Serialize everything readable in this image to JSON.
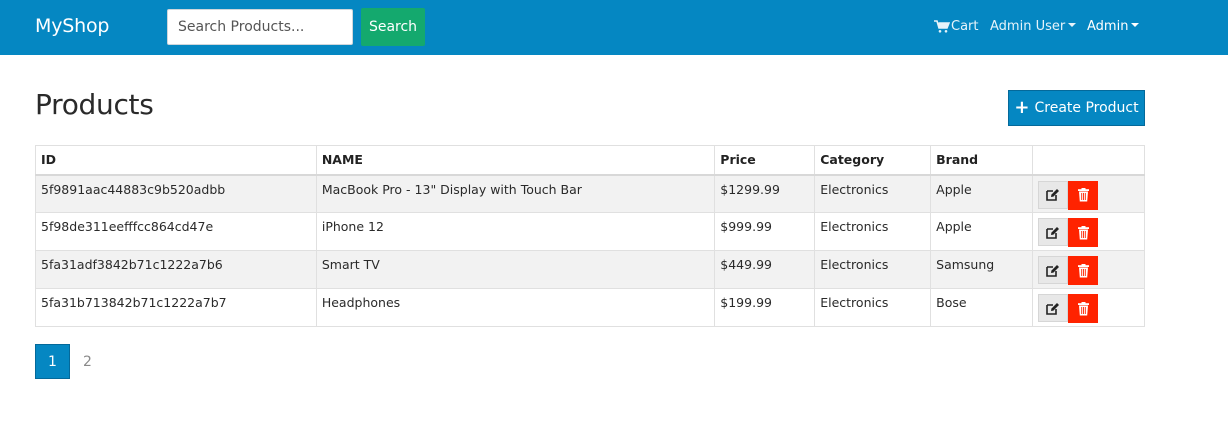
{
  "navbar": {
    "brand": "MyShop",
    "search_placeholder": "Search Products...",
    "search_button": "Search",
    "cart_label": "Cart",
    "cart_icon": "shopping-cart-icon",
    "admin_user_label": "Admin User",
    "admin_label": "Admin",
    "background_color": "#0587c2",
    "search_button_color": "#14a96e"
  },
  "page": {
    "title": "Products",
    "create_button": "Create Product"
  },
  "table": {
    "headers": [
      "ID",
      "NAME",
      "Price",
      "Category",
      "Brand",
      ""
    ],
    "rows": [
      {
        "id": "5f9891aac44883c9b520adbb",
        "name": "MacBook Pro - 13\" Display with Touch Bar",
        "price": "$1299.99",
        "category": "Electronics",
        "brand": "Apple"
      },
      {
        "id": "5f98de311eefffcc864cd47e",
        "name": "iPhone 12",
        "price": "$999.99",
        "category": "Electronics",
        "brand": "Apple"
      },
      {
        "id": "5fa31adf3842b71c1222a7b6",
        "name": "Smart TV",
        "price": "$449.99",
        "category": "Electronics",
        "brand": "Samsung"
      },
      {
        "id": "5fa31b713842b71c1222a7b7",
        "name": "Headphones",
        "price": "$199.99",
        "category": "Electronics",
        "brand": "Bose"
      }
    ],
    "edit_icon": "edit-icon",
    "delete_icon": "trash-icon",
    "delete_color": "#ff2300"
  },
  "pagination": {
    "pages": [
      "1",
      "2"
    ],
    "active": "1"
  }
}
